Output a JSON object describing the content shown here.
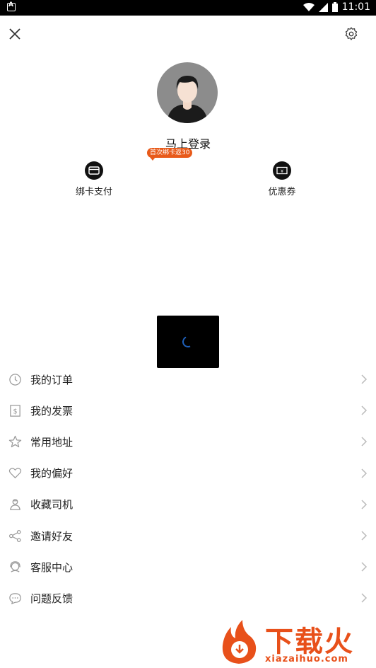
{
  "status_bar": {
    "time": "11:01"
  },
  "profile": {
    "login_label": "马上登录",
    "promo_badge": "首次绑卡返30"
  },
  "quick_actions": [
    {
      "label": "绑卡支付",
      "icon": "card-icon"
    },
    {
      "label": "优惠券",
      "icon": "coupon-icon"
    }
  ],
  "menu": [
    {
      "label": "我的订单",
      "icon": "clock-icon"
    },
    {
      "label": "我的发票",
      "icon": "invoice-icon"
    },
    {
      "label": "常用地址",
      "icon": "star-icon"
    },
    {
      "label": "我的偏好",
      "icon": "heart-icon"
    },
    {
      "label": "收藏司机",
      "icon": "driver-icon"
    },
    {
      "label": "邀请好友",
      "icon": "share-icon"
    },
    {
      "label": "客服中心",
      "icon": "headset-icon"
    },
    {
      "label": "问题反馈",
      "icon": "chat-icon"
    }
  ],
  "watermark": {
    "title": "下载火",
    "url": "xiazaihuo.com"
  },
  "colors": {
    "accent": "#e85a1a",
    "spinner": "#1e5fb8"
  }
}
